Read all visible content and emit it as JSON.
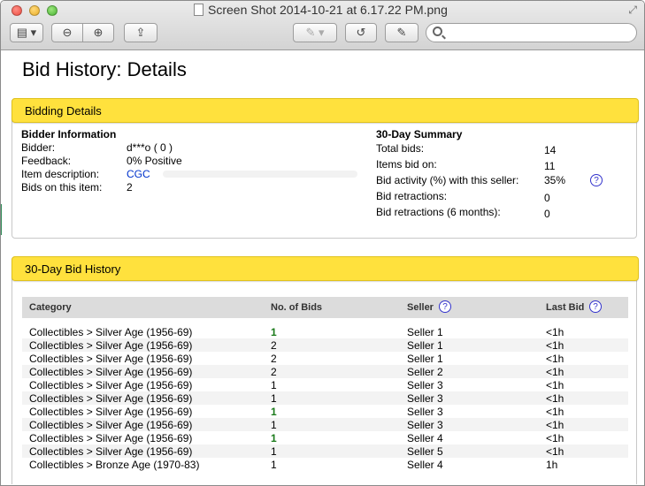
{
  "window": {
    "title": "Screen Shot 2014-10-21 at 6.17.22 PM.png"
  },
  "page": {
    "heading": "Bid History: Details"
  },
  "bidding_details": {
    "section_title": "Bidding Details",
    "bidder_info": {
      "title": "Bidder Information",
      "rows": [
        {
          "label": "Bidder:",
          "value": "d***o ( 0 )"
        },
        {
          "label": "Feedback:",
          "value": "0% Positive"
        },
        {
          "label": "Item description:",
          "value": "CGC"
        },
        {
          "label": "Bids on this item:",
          "value": "2"
        }
      ]
    },
    "summary": {
      "title": "30-Day Summary",
      "rows": [
        {
          "label": "Total bids:",
          "value": "14"
        },
        {
          "label": "Items bid on:",
          "value": "11"
        },
        {
          "label": "Bid activity (%) with this seller:",
          "value": "35%"
        },
        {
          "label": "Bid retractions:",
          "value": "0"
        },
        {
          "label": "Bid retractions (6 months):",
          "value": "0"
        }
      ]
    }
  },
  "history": {
    "section_title": "30-Day Bid History",
    "columns": [
      "Category",
      "No. of Bids",
      "Seller",
      "Last Bid"
    ],
    "rows": [
      {
        "category": "Collectibles > Silver Age (1956-69)",
        "bids": "1",
        "seller": "Seller 1",
        "last": "<1h",
        "highlight": true
      },
      {
        "category": "Collectibles > Silver Age (1956-69)",
        "bids": "2",
        "seller": "Seller 1",
        "last": "<1h",
        "highlight": false
      },
      {
        "category": "Collectibles > Silver Age (1956-69)",
        "bids": "2",
        "seller": "Seller 1",
        "last": "<1h",
        "highlight": false
      },
      {
        "category": "Collectibles > Silver Age (1956-69)",
        "bids": "2",
        "seller": "Seller 2",
        "last": "<1h",
        "highlight": false
      },
      {
        "category": "Collectibles > Silver Age (1956-69)",
        "bids": "1",
        "seller": "Seller 3",
        "last": "<1h",
        "highlight": false
      },
      {
        "category": "Collectibles > Silver Age (1956-69)",
        "bids": "1",
        "seller": "Seller 3",
        "last": "<1h",
        "highlight": false
      },
      {
        "category": "Collectibles > Silver Age (1956-69)",
        "bids": "1",
        "seller": "Seller 3",
        "last": "<1h",
        "highlight": true
      },
      {
        "category": "Collectibles > Silver Age (1956-69)",
        "bids": "1",
        "seller": "Seller 3",
        "last": "<1h",
        "highlight": false
      },
      {
        "category": "Collectibles > Silver Age (1956-69)",
        "bids": "1",
        "seller": "Seller 4",
        "last": "<1h",
        "highlight": true
      },
      {
        "category": "Collectibles > Silver Age (1956-69)",
        "bids": "1",
        "seller": "Seller 5",
        "last": "<1h",
        "highlight": false
      },
      {
        "category": "Collectibles > Bronze Age (1970-83)",
        "bids": "1",
        "seller": "Seller 4",
        "last": "1h",
        "highlight": false
      }
    ]
  },
  "icons": {
    "help": "?"
  }
}
